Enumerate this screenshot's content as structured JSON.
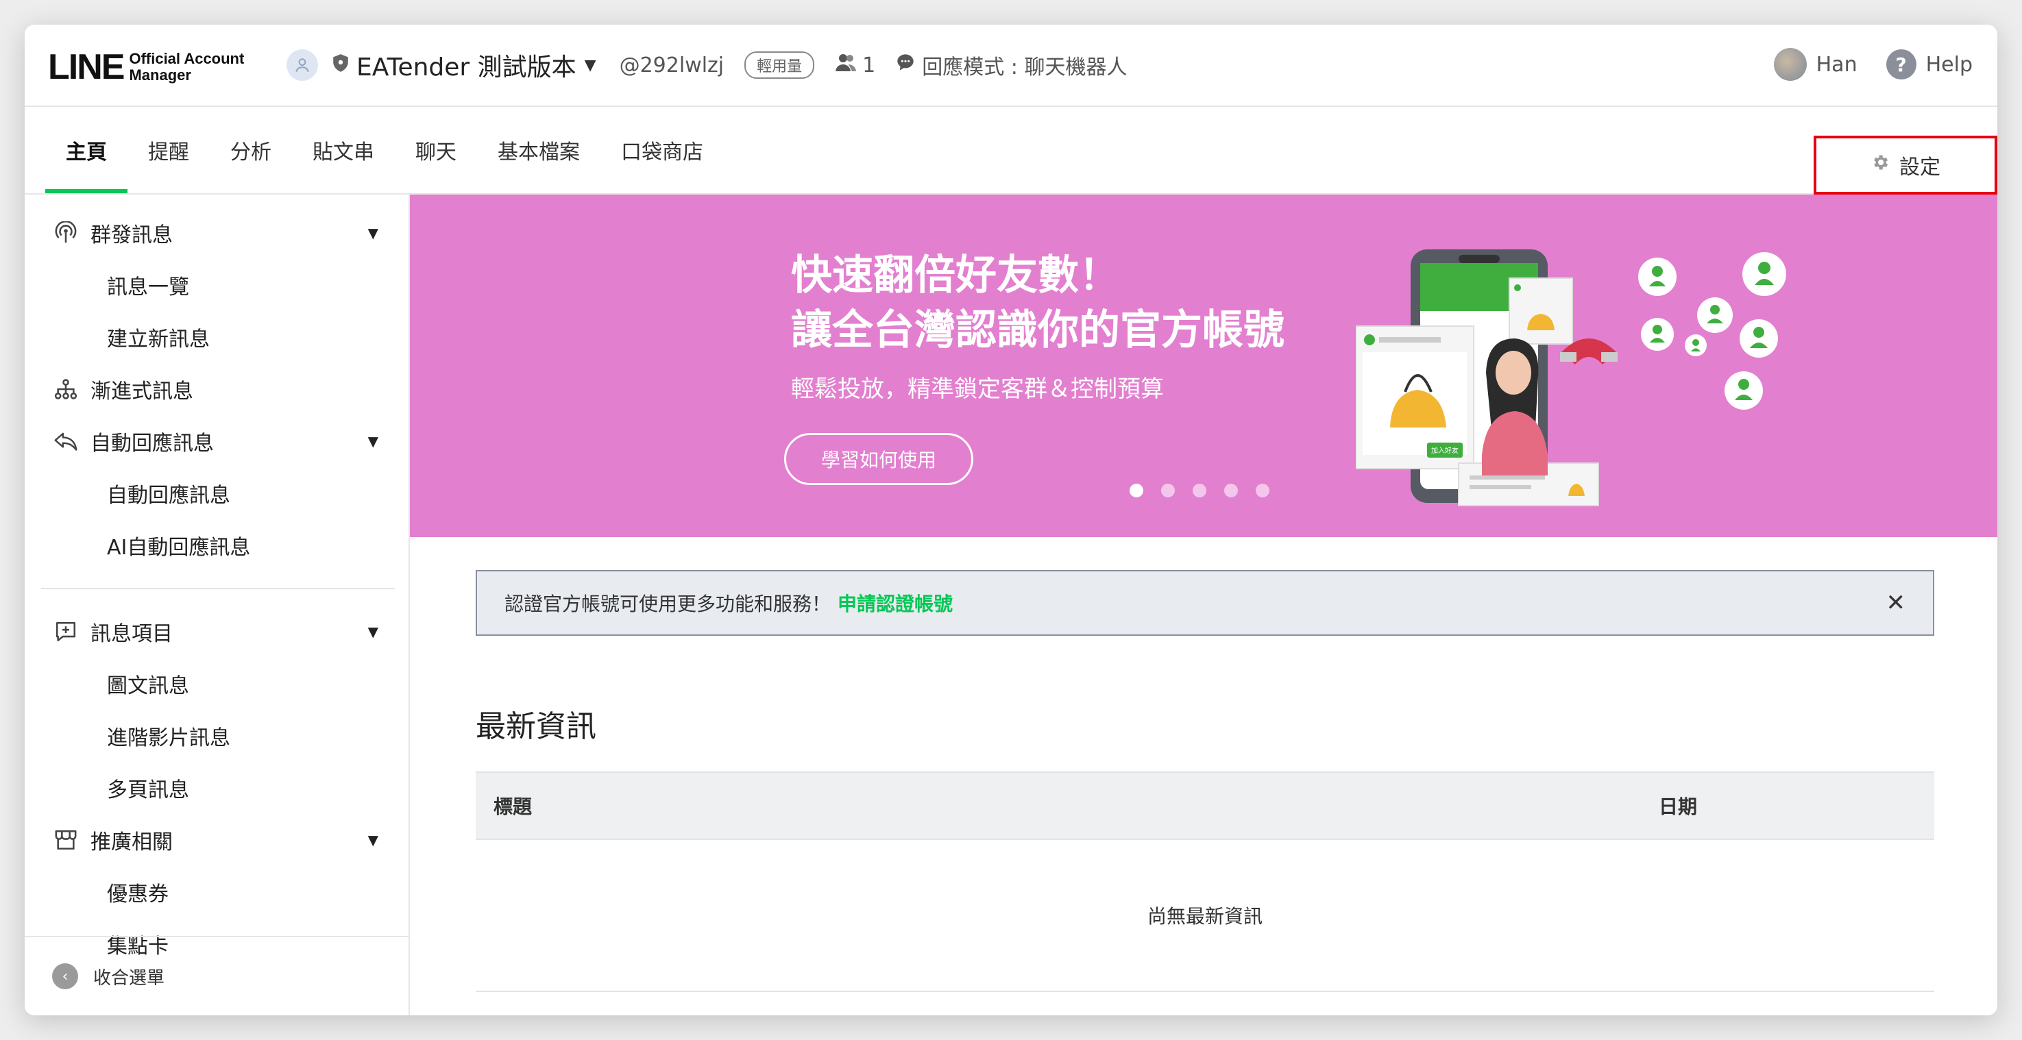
{
  "app": {
    "logo_main": "LINE",
    "logo_sub_1": "Official Account",
    "logo_sub_2": "Manager"
  },
  "header": {
    "account_name": "EATender 測試版本",
    "account_id": "@292lwlzj",
    "plan_badge": "輕用量",
    "friend_count": "1",
    "response_mode": "回應模式 : 聊天機器人",
    "user_name": "Han",
    "help_label": "Help"
  },
  "nav": {
    "tabs": [
      {
        "label": "主頁",
        "active": true
      },
      {
        "label": "提醒"
      },
      {
        "label": "分析"
      },
      {
        "label": "貼文串"
      },
      {
        "label": "聊天"
      },
      {
        "label": "基本檔案"
      },
      {
        "label": "口袋商店"
      }
    ],
    "settings_label": "設定"
  },
  "sidebar": {
    "broadcast": {
      "label": "群發訊息",
      "items": [
        "訊息一覽",
        "建立新訊息"
      ]
    },
    "step_message": {
      "label": "漸進式訊息"
    },
    "auto_reply": {
      "label": "自動回應訊息",
      "items": [
        "自動回應訊息",
        "AI自動回應訊息"
      ]
    },
    "message_items": {
      "label": "訊息項目",
      "items": [
        "圖文訊息",
        "進階影片訊息",
        "多頁訊息"
      ]
    },
    "promotion": {
      "label": "推廣相關",
      "items": [
        "優惠券",
        "集點卡"
      ]
    },
    "collapse_label": "收合選單"
  },
  "banner": {
    "title_line1": "快速翻倍好友數！",
    "title_line2": "讓全台灣認識你的官方帳號",
    "subtitle": "輕鬆投放，精準鎖定客群＆控制預算",
    "button_label": "學習如何使用",
    "add_friend_label": "加入好友",
    "slides": 5,
    "active_slide": 1
  },
  "notice": {
    "text": "認證官方帳號可使用更多功能和服務！",
    "link_label": "申請認證帳號"
  },
  "news": {
    "title": "最新資訊",
    "col_title": "標題",
    "col_date": "日期",
    "empty_text": "尚無最新資訊"
  },
  "colors": {
    "line_green": "#06c755",
    "banner_pink": "#e37fcf",
    "highlight_red": "#e60012"
  }
}
